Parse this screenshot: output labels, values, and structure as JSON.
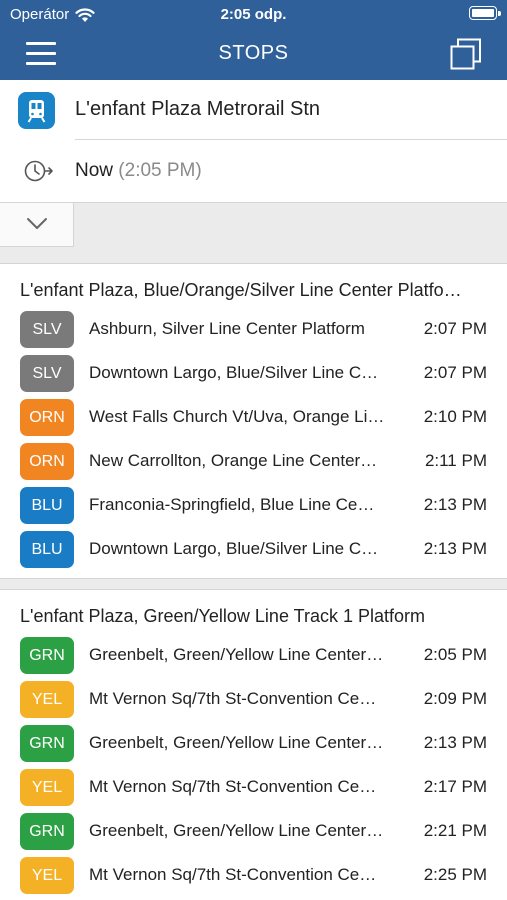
{
  "status_bar": {
    "carrier": "Operátor",
    "time": "2:05 odp."
  },
  "nav": {
    "title": "STOPS",
    "menu_icon": "hamburger-menu-icon",
    "copy_icon": "copy-icon"
  },
  "stop": {
    "name": "L'enfant Plaza Metrorail Stn",
    "icon": "metro-train-icon"
  },
  "time": {
    "label": "Now",
    "value": "(2:05 PM)",
    "icon": "clock-arrow-icon"
  },
  "collapse": {
    "icon": "chevron-down-icon"
  },
  "colors": {
    "header": "#30609a",
    "SLV": "#7a7a7a",
    "ORN": "#f08522",
    "BLU": "#1a7cc4",
    "GRN": "#2ca044",
    "YEL": "#f5b125"
  },
  "sections": [
    {
      "title": "L'enfant Plaza, Blue/Orange/Silver Line Center Platfo…",
      "arrivals": [
        {
          "line": "SLV",
          "destination": "Ashburn, Silver Line Center Platform",
          "time": "2:07 PM"
        },
        {
          "line": "SLV",
          "destination": "Downtown Largo, Blue/Silver Line C…",
          "time": "2:07 PM"
        },
        {
          "line": "ORN",
          "destination": "West Falls Church Vt/Uva, Orange Li…",
          "time": "2:10 PM"
        },
        {
          "line": "ORN",
          "destination": "New Carrollton, Orange Line Center…",
          "time": "2:11 PM"
        },
        {
          "line": "BLU",
          "destination": "Franconia-Springfield, Blue Line Ce…",
          "time": "2:13 PM"
        },
        {
          "line": "BLU",
          "destination": "Downtown Largo, Blue/Silver Line C…",
          "time": "2:13 PM"
        }
      ]
    },
    {
      "title": "L'enfant Plaza, Green/Yellow Line Track 1 Platform",
      "arrivals": [
        {
          "line": "GRN",
          "destination": "Greenbelt, Green/Yellow Line Center…",
          "time": "2:05 PM"
        },
        {
          "line": "YEL",
          "destination": "Mt Vernon Sq/7th St-Convention Ce…",
          "time": "2:09 PM"
        },
        {
          "line": "GRN",
          "destination": "Greenbelt, Green/Yellow Line Center…",
          "time": "2:13 PM"
        },
        {
          "line": "YEL",
          "destination": "Mt Vernon Sq/7th St-Convention Ce…",
          "time": "2:17 PM"
        },
        {
          "line": "GRN",
          "destination": "Greenbelt, Green/Yellow Line Center…",
          "time": "2:21 PM"
        },
        {
          "line": "YEL",
          "destination": "Mt Vernon Sq/7th St-Convention Ce…",
          "time": "2:25 PM"
        }
      ]
    }
  ]
}
